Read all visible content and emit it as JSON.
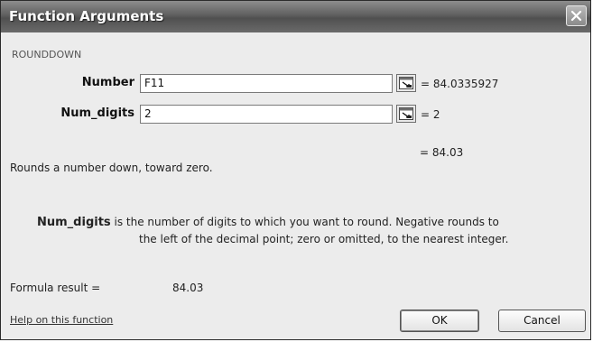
{
  "window": {
    "title": "Function Arguments"
  },
  "function": {
    "name": "ROUNDDOWN"
  },
  "args": [
    {
      "label": "Number",
      "value": "F11",
      "evaluated": "= 84.0335927"
    },
    {
      "label": "Num_digits",
      "value": "2",
      "evaluated": "= 2"
    }
  ],
  "result_preview": "= 84.03",
  "description": "Rounds a number down, toward zero.",
  "arg_help": {
    "label": "Num_digits",
    "text_line1": "is the number of digits to which you want to round. Negative rounds to",
    "text_line2": "the left of the decimal point; zero or omitted, to the nearest integer."
  },
  "formula_result": {
    "label": "Formula result =",
    "value": "84.03"
  },
  "footer": {
    "help_link": "Help on this function",
    "ok_label": "OK",
    "cancel_label": "Cancel"
  },
  "icons": {
    "close": "close-icon",
    "refedit": "collapse-dialog-icon"
  }
}
